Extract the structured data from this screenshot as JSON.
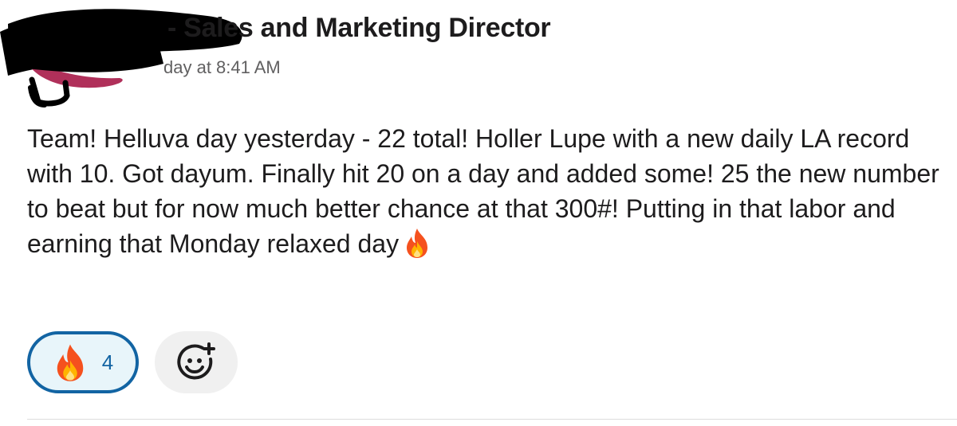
{
  "message": {
    "sender_suffix": "- Sales and Marketing Director",
    "timestamp": "day at 8:41 AM",
    "text": "Team! Helluva day yesterday - 22 total! Holler Lupe with a new daily LA record with 10. Got dayum. Finally hit 20 on a day and added some! 25 the new number to beat but for now much better chance at that 300#! Putting in that labor and earning that Monday relaxed day",
    "inline_emoji": "fire-icon"
  },
  "reactions": [
    {
      "emoji": "fire-icon",
      "count": "4"
    }
  ],
  "add_reaction": {
    "icon": "add-reaction-icon"
  },
  "colors": {
    "accent": "#1264a3",
    "reaction_bg": "#e8f5fa",
    "text": "#1d1c1d",
    "muted": "#616061"
  }
}
